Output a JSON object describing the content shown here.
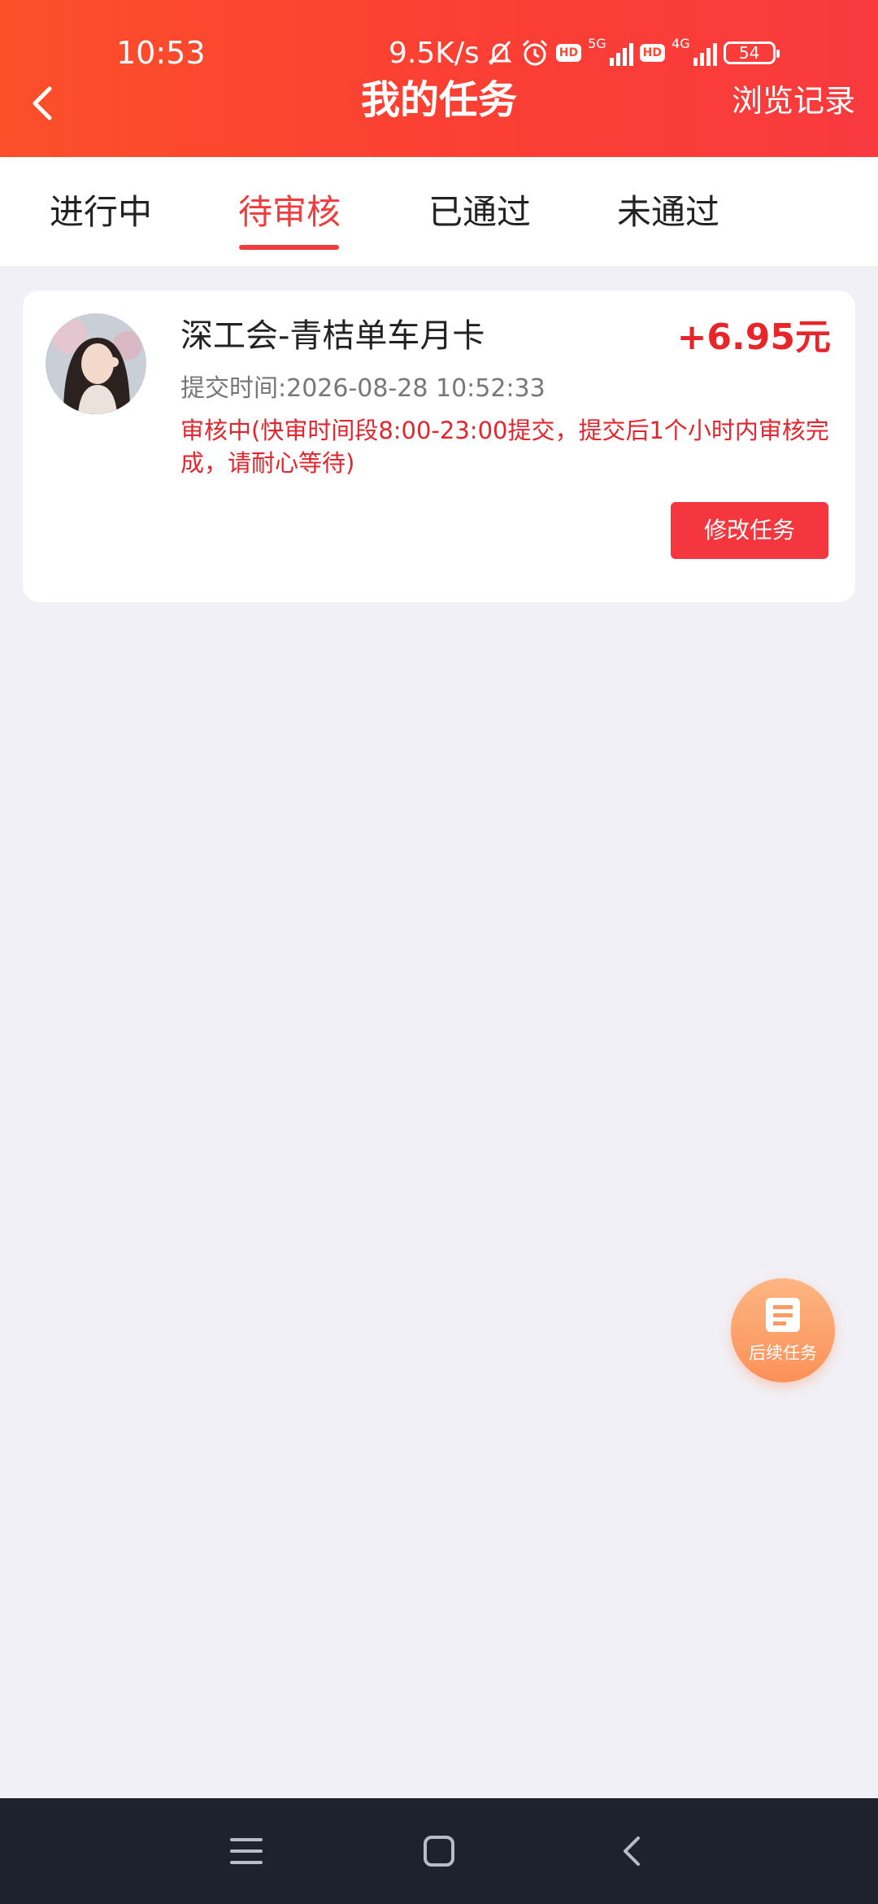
{
  "status_bar": {
    "time": "10:53",
    "net_speed": "9.5K/s",
    "hd_badge": "HD",
    "net_5g": "5G",
    "net_4g": "4G",
    "battery": "54"
  },
  "header": {
    "title": "我的任务",
    "history_link": "浏览记录"
  },
  "tabs": [
    {
      "label": "进行中",
      "active": false
    },
    {
      "label": "待审核",
      "active": true
    },
    {
      "label": "已通过",
      "active": false
    },
    {
      "label": "未通过",
      "active": false
    }
  ],
  "task": {
    "title": "深工会-青桔单车月卡",
    "reward": "+6.95元",
    "submit_time": "提交时间:2026-08-28 10:52:33",
    "review_note": "审核中(快审时间段8:00-23:00提交，提交后1个小时内审核完成，请耐心等待)",
    "edit_button": "修改任务"
  },
  "fab": {
    "label": "后续任务"
  },
  "colors": {
    "header_start": "#fc4f2a",
    "header_end": "#f93a3e",
    "accent": "#ef3d3d",
    "reward": "#e8262a",
    "fab": "#fb9058",
    "nav_bar": "#1e222e"
  }
}
